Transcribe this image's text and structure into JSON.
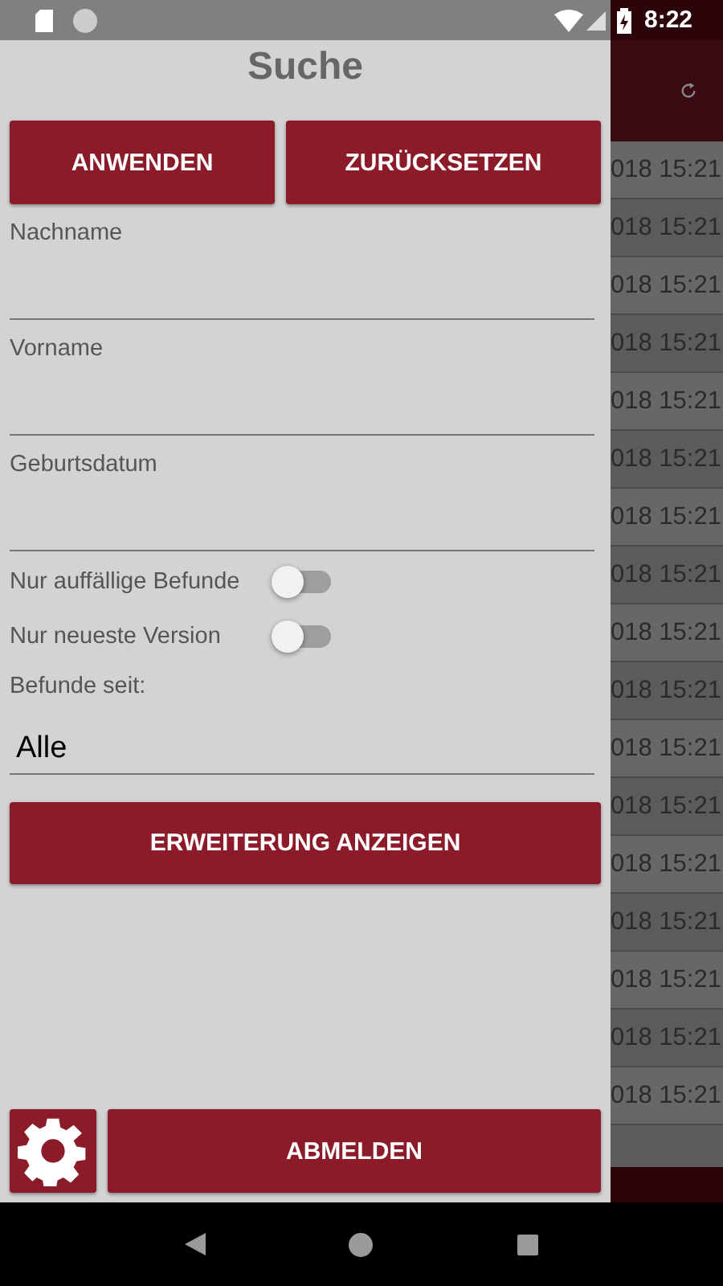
{
  "status_bar": {
    "time": "8:22"
  },
  "drawer": {
    "title": "Suche",
    "top_buttons": [
      "ANWENDEN",
      "ZURÜCKSETZEN"
    ],
    "fields": [
      {
        "label": "Nachname"
      },
      {
        "label": "Vorname"
      },
      {
        "label": "Geburtsdatum"
      }
    ],
    "switches": [
      {
        "label": "Nur auffällige Befunde",
        "on": false
      },
      {
        "label": "Nur neueste Version",
        "on": false
      }
    ],
    "since": {
      "label": "Befunde seit:",
      "value": "Alle"
    },
    "extend_button": "ERWEITERUNG ANZEIGEN",
    "logout_button": "ABMELDEN"
  },
  "background_list": {
    "rows": [
      {
        "text": "018 15:21"
      },
      {
        "text": "018 15:21"
      },
      {
        "text": "018 15:21"
      },
      {
        "text": "018 15:21"
      },
      {
        "text": "018 15:21"
      },
      {
        "text": "018 15:21"
      },
      {
        "text": "018 15:21"
      },
      {
        "text": "018 15:21"
      },
      {
        "text": "018 15:21"
      },
      {
        "text": "018 15:21"
      },
      {
        "text": "018 15:21"
      },
      {
        "text": "018 15:21"
      },
      {
        "text": "018 15:21"
      },
      {
        "text": "018 15:21"
      },
      {
        "text": "018 15:21"
      },
      {
        "text": "018 15:21"
      },
      {
        "text": "018 15:21"
      }
    ]
  }
}
